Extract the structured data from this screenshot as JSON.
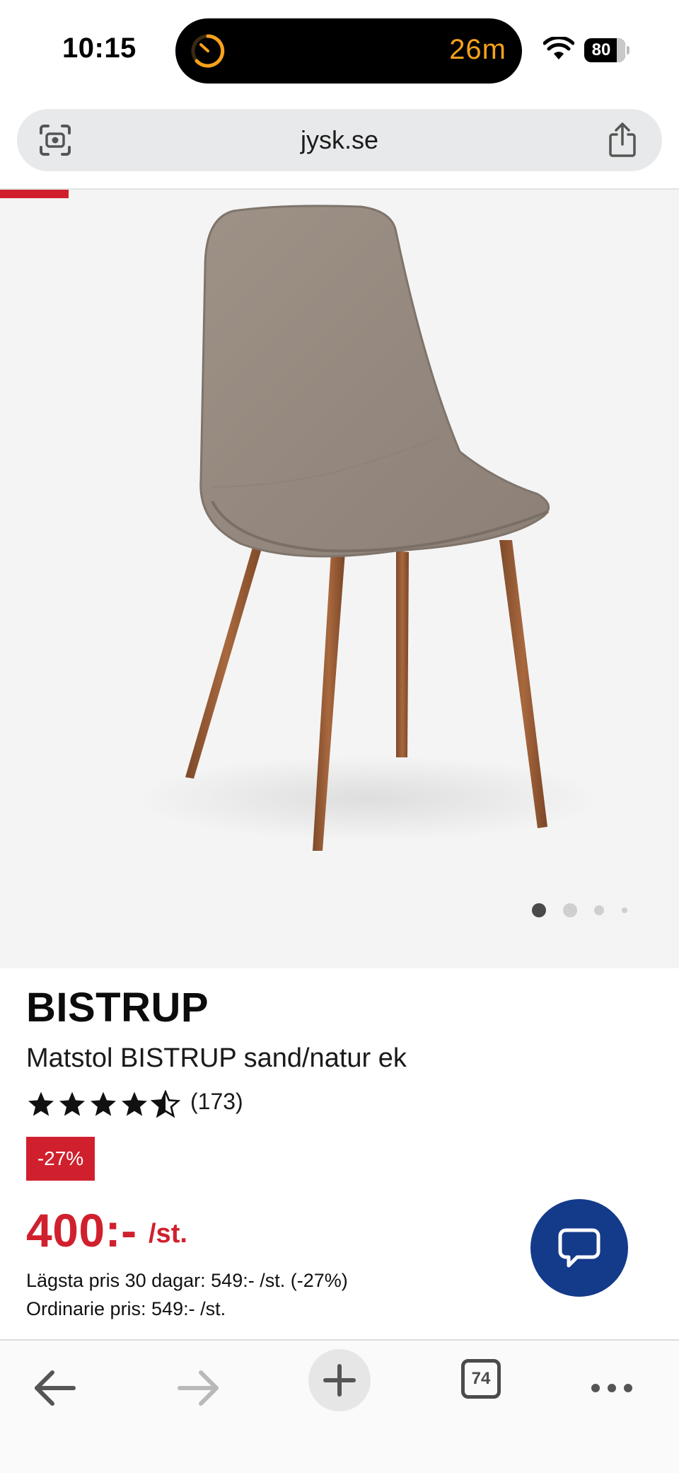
{
  "status_bar": {
    "time": "10:15",
    "timer_text": "26m",
    "battery_level": "80",
    "icons": [
      "timer-icon",
      "wifi-icon",
      "battery-icon"
    ],
    "timer_color": "#f7a21b"
  },
  "browser": {
    "url": "jysk.se",
    "left_icon": "scan-icon",
    "right_icon": "share-icon"
  },
  "product": {
    "image_alt": "chair-photo",
    "carousel": {
      "total": 4,
      "active": 0
    },
    "brand": "BISTRUP",
    "subtitle": "Matstol BISTRUP sand/natur ek",
    "rating": {
      "stars": 4.5,
      "max": 5,
      "review_count": "(173)"
    },
    "discount_badge": "-27%",
    "price": "400:-",
    "price_unit": "/st.",
    "lowest_price_line": "Lägsta pris 30 dagar: 549:- /st. (-27%)",
    "regular_price_line": "Ordinarie pris: 549:- /st.",
    "accent_color": "#d0202e"
  },
  "chat": {
    "icon": "chat-bubble-icon",
    "color": "#143a8a"
  },
  "toolbar": {
    "back_icon": "back-arrow-icon",
    "forward_icon": "forward-arrow-icon",
    "new_tab_icon": "plus-icon",
    "tabs_count": "74",
    "more_icon": "more-dots-icon"
  }
}
